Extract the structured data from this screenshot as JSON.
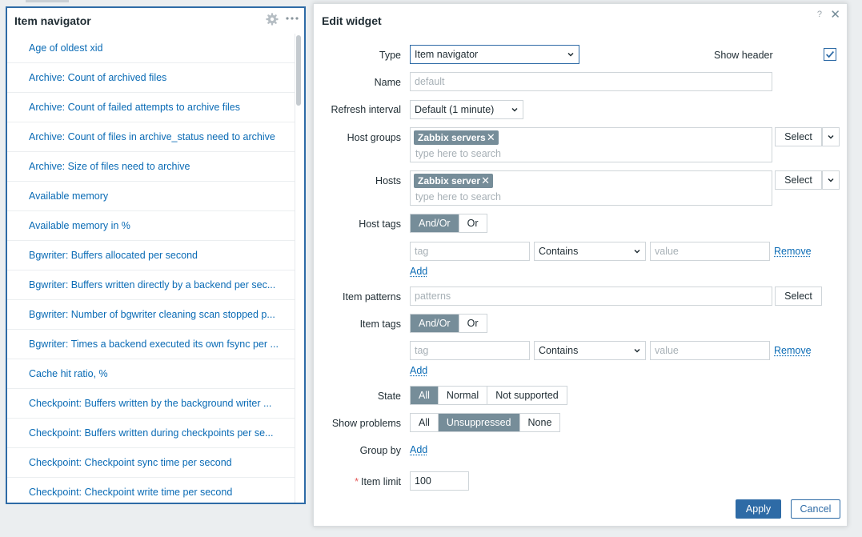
{
  "widget": {
    "title": "Item navigator",
    "items": [
      "Age of oldest xid",
      "Archive: Count of archived files",
      "Archive: Count of failed attempts to archive files",
      "Archive: Count of files in archive_status need to archive",
      "Archive: Size of files need to archive",
      "Available memory",
      "Available memory in %",
      "Bgwriter: Buffers allocated per second",
      "Bgwriter: Buffers written directly by a backend per sec...",
      "Bgwriter: Number of bgwriter cleaning scan stopped p...",
      "Bgwriter: Times a backend executed its own fsync per ...",
      "Cache hit ratio, %",
      "Checkpoint: Buffers written by the background writer ...",
      "Checkpoint: Buffers written during checkpoints per se...",
      "Checkpoint: Checkpoint sync time per second",
      "Checkpoint: Checkpoint write time per second"
    ]
  },
  "dialog": {
    "title": "Edit widget",
    "help": "?",
    "close": "✕",
    "labels": {
      "type": "Type",
      "name": "Name",
      "refresh": "Refresh interval",
      "host_groups": "Host groups",
      "hosts": "Hosts",
      "host_tags": "Host tags",
      "item_patterns": "Item patterns",
      "item_tags": "Item tags",
      "state": "State",
      "show_problems": "Show problems",
      "group_by": "Group by",
      "item_limit": "Item limit",
      "required": "*",
      "show_header": "Show header"
    },
    "type_value": "Item navigator",
    "name_placeholder": "default",
    "refresh_value": "Default (1 minute)",
    "host_groups_chip": "Zabbix servers",
    "hosts_chip": "Zabbix server",
    "chip_remove": "✕",
    "search_placeholder": "type here to search",
    "select_label": "Select",
    "andor": [
      "And/Or",
      "Or"
    ],
    "tag_placeholder": "tag",
    "operator_value": "Contains",
    "value_placeholder": "value",
    "remove_label": "Remove",
    "add_label": "Add",
    "patterns_placeholder": "patterns",
    "state_options": [
      "All",
      "Normal",
      "Not supported"
    ],
    "problem_options": [
      "All",
      "Unsuppressed",
      "None"
    ],
    "item_limit_value": "100",
    "apply_label": "Apply",
    "cancel_label": "Cancel",
    "checkmark": "✓"
  },
  "colors": {
    "accent": "#2e6ba6",
    "link": "#0a6bb5",
    "segment_active": "#768d99",
    "required": "#e45959"
  }
}
